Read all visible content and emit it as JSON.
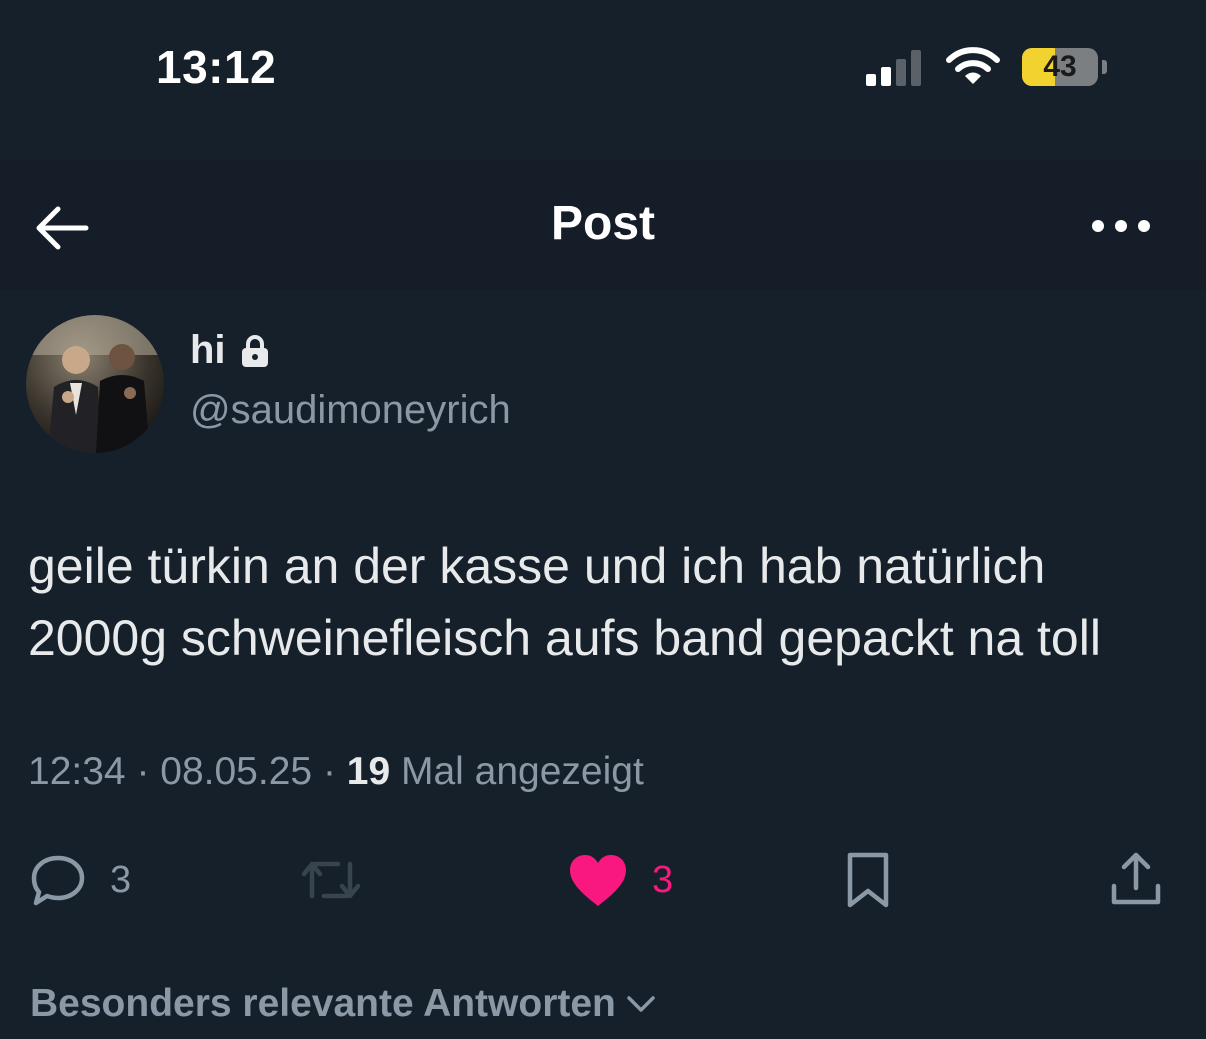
{
  "status_bar": {
    "time": "13:12",
    "battery_level": "43",
    "icons": [
      "signal-icon",
      "wifi-icon",
      "battery-icon"
    ]
  },
  "header": {
    "title": "Post",
    "back_icon": "back-arrow-icon",
    "more_icon": "more-options-icon"
  },
  "author": {
    "display_name": "hi",
    "handle": "@saudimoneyrich",
    "locked_icon": "lock-icon"
  },
  "tweet": {
    "text": "geile türkin an der kasse und ich hab natürlich\n2000g schweinefleisch aufs band gepackt na toll",
    "time": "12:34",
    "date": "08.05.25",
    "views_count": "19",
    "views_label": "Mal angezeigt"
  },
  "actions": {
    "reply_count": "3",
    "like_count": "3"
  },
  "replies": {
    "filter_label": "Besonders relevante Antworten"
  },
  "colors": {
    "background": "#15202b",
    "text": "#e7e9ea",
    "secondary": "#8b98a5",
    "like": "#f91880",
    "battery": "#f2d22e"
  }
}
